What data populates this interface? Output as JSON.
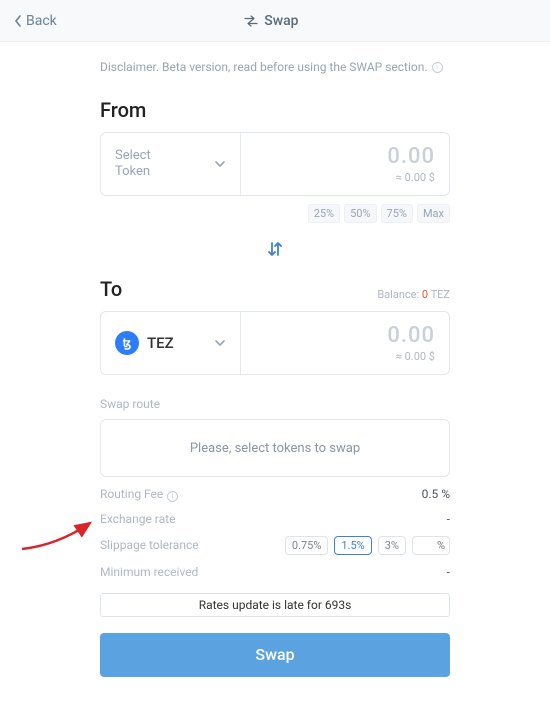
{
  "header": {
    "back_label": "Back",
    "title": "Swap"
  },
  "disclaimer": "Disclaimer. Beta version, read before using the SWAP section.",
  "from": {
    "section_label": "From",
    "select_placeholder": "Select\nToken",
    "amount": "0.00",
    "amount_fiat": "≈ 0.00 $",
    "pct": [
      "25%",
      "50%",
      "75%",
      "Max"
    ]
  },
  "to": {
    "section_label": "To",
    "balance_label": "Balance:",
    "balance_value": "0",
    "balance_unit": "TEZ",
    "token_symbol": "TEZ",
    "amount": "0.00",
    "amount_fiat": "≈ 0.00 $"
  },
  "route": {
    "label": "Swap route",
    "empty_msg": "Please, select tokens to swap"
  },
  "stats": {
    "routing_fee_label": "Routing Fee",
    "routing_fee_value": "0.5 %",
    "exchange_rate_label": "Exchange rate",
    "exchange_rate_value": "-",
    "slippage_label": "Slippage tolerance",
    "slippage_options": [
      "0.75%",
      "1.5%",
      "3%"
    ],
    "slippage_selected": "1.5%",
    "slippage_custom_placeholder": "%",
    "min_received_label": "Minimum received",
    "min_received_value": "-"
  },
  "warning": "Rates update is late for 693s",
  "swap_button": "Swap"
}
